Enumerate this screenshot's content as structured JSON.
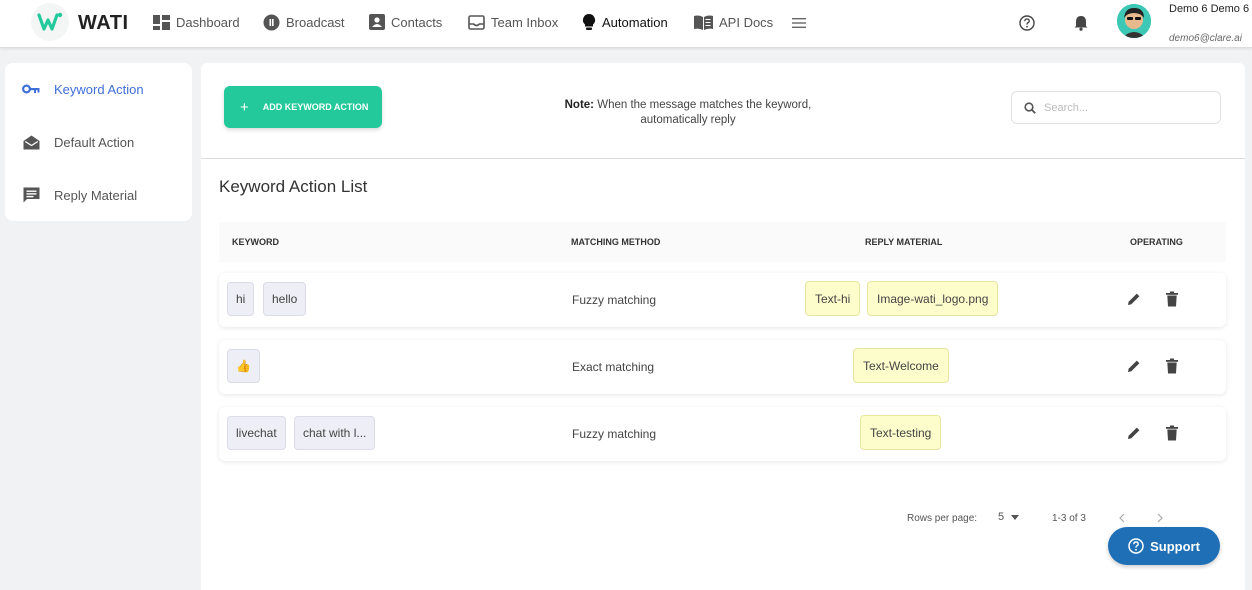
{
  "header": {
    "brand": "WATI",
    "nav": {
      "dashboard": "Dashboard",
      "broadcast": "Broadcast",
      "contacts": "Contacts",
      "team_inbox": "Team Inbox",
      "automation": "Automation",
      "api_docs": "API Docs"
    },
    "user": {
      "name": "Demo 6 Demo 6",
      "email": "demo6@clare.ai"
    }
  },
  "sidebar": {
    "items": [
      {
        "label": "Keyword Action",
        "icon": "key-icon",
        "active": true
      },
      {
        "label": "Default Action",
        "icon": "envelope-open-icon",
        "active": false
      },
      {
        "label": "Reply Material",
        "icon": "message-icon",
        "active": false
      }
    ]
  },
  "toolbar": {
    "add_button": "ADD KEYWORD ACTION",
    "note_label": "Note:",
    "note_text": "When the message matches the keyword, automatically reply",
    "search_placeholder": "Search..."
  },
  "list": {
    "title": "Keyword Action List",
    "columns": {
      "keyword": "KEYWORD",
      "matching_method": "MATCHING METHOD",
      "reply_material": "REPLY MATERIAL",
      "operating": "OPERATING"
    },
    "rows": [
      {
        "keywords": [
          "hi",
          "hello"
        ],
        "method": "Fuzzy matching",
        "replies": [
          "Text-hi",
          "Image-wati_logo.png"
        ]
      },
      {
        "keywords": [
          "👍"
        ],
        "method": "Exact matching",
        "replies": [
          "Text-Welcome"
        ]
      },
      {
        "keywords": [
          "livechat",
          "chat with l..."
        ],
        "method": "Fuzzy matching",
        "replies": [
          "Text-testing"
        ]
      }
    ]
  },
  "pagination": {
    "rows_per_page_label": "Rows per page:",
    "rows_per_page": "5",
    "range": "1-3 of 3"
  },
  "support": {
    "label": "Support"
  },
  "colors": {
    "accent_green": "#23c99a",
    "active_blue": "#3f6fd8",
    "support_blue": "#1e6fb6",
    "reply_chip": "#fdfdcc"
  }
}
